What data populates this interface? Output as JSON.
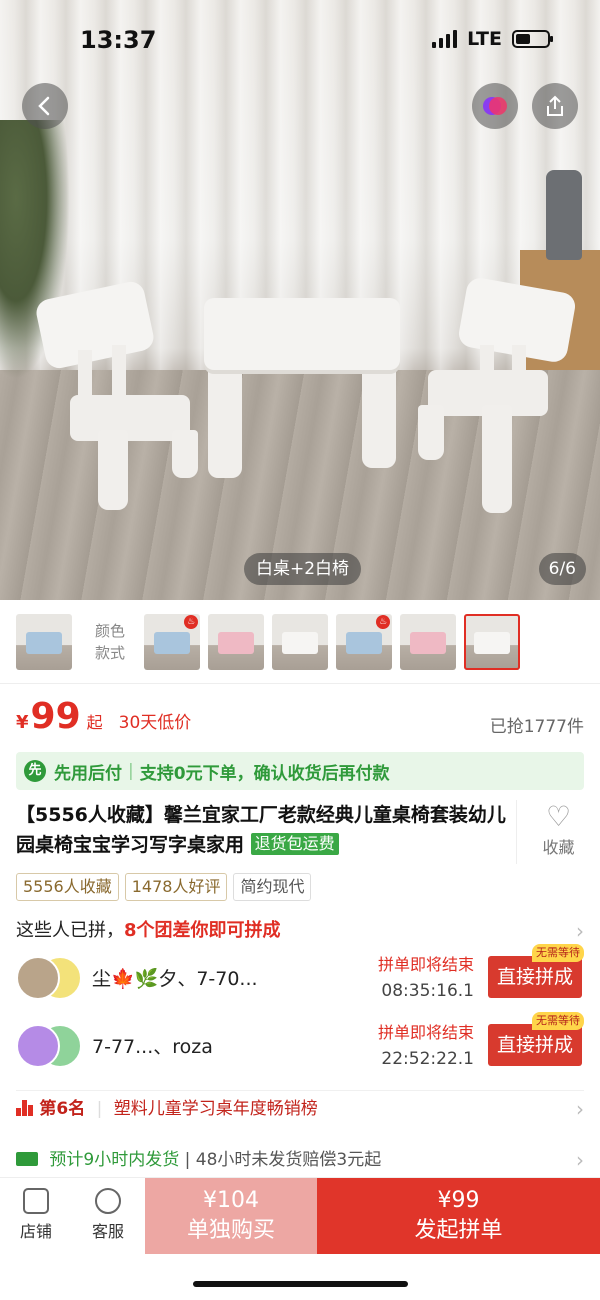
{
  "status_bar": {
    "time": "13:37",
    "network": "LTE"
  },
  "hero": {
    "variant_label": "白桌+2白椅",
    "page_counter": "6/6"
  },
  "color_selector": {
    "label_line1": "颜色",
    "label_line2": "款式"
  },
  "price": {
    "currency": "¥",
    "value": "99",
    "suffix": "起",
    "tag": "30天低价",
    "sold": "已抢1777件"
  },
  "promo": {
    "icon_text": "先",
    "main": "先用后付",
    "separator": "|",
    "detail": "支持0元下单，确认收货后再付款"
  },
  "product": {
    "title": "【5556人收藏】馨兰宜家工厂老款经典儿童桌椅套装幼儿园桌椅宝宝学习写字桌家用",
    "badge": "退货包运费",
    "favorite_label": "收藏"
  },
  "tags": [
    "5556人收藏",
    "1478人好评",
    "简约现代"
  ],
  "group_header": {
    "prefix": "这些人已拼，",
    "highlight": "8个团差你即可拼成"
  },
  "groups": [
    {
      "name": "尘🍁🌿夕、7-70...",
      "status": "拼单即将结束",
      "countdown": "08:35:16.1",
      "button": "直接拼成",
      "badge": "无需等待"
    },
    {
      "name": "7-77...、roza",
      "status": "拼单即将结束",
      "countdown": "22:52:22.1",
      "button": "直接拼成",
      "badge": "无需等待"
    }
  ],
  "ranking": {
    "rank": "第6名",
    "separator": "|",
    "list": "塑料儿童学习桌年度畅销榜"
  },
  "shipping": {
    "main": "预计9小时内发货",
    "separator": "|",
    "detail": "48小时未发货赔偿3元起"
  },
  "bottom_bar": {
    "store_label": "店铺",
    "service_label": "客服",
    "alone_price": "¥104",
    "alone_label": "单独购买",
    "group_price": "¥99",
    "group_label": "发起拼单"
  },
  "colors": {
    "accent": "#e02e24",
    "green": "#2f9a3a",
    "button_red": "#d83a2e"
  }
}
